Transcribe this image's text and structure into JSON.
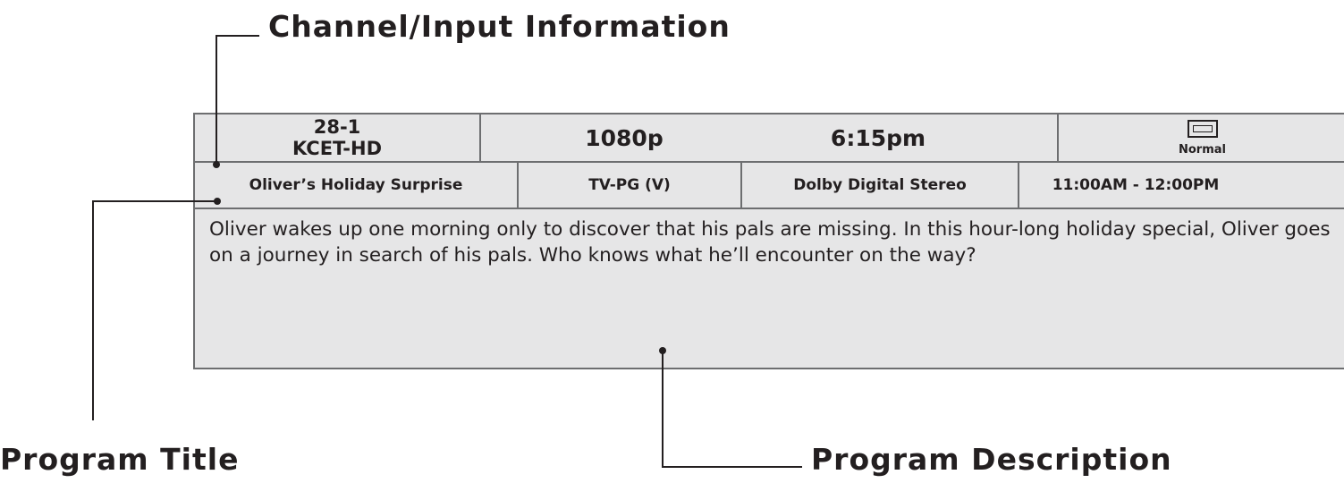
{
  "callouts": {
    "channel_input": "Channel/Input Information",
    "program_title": "Program Title",
    "program_description": "Program Description"
  },
  "banner": {
    "channel_number": "28-1",
    "channel_name": "KCET-HD",
    "resolution": "1080p",
    "time": "6:15pm",
    "picture_size_icon": "aspect-ratio-icon",
    "picture_size": "Normal",
    "program_title": "Oliver’s Holiday Surprise",
    "rating": "TV-PG (V)",
    "audio": "Dolby Digital Stereo",
    "time_slot": "11:00AM - 12:00PM",
    "description": "Oliver wakes up one morning only to discover that his pals are missing. In this hour-long holiday special, Oliver goes on a journey in search of his pals. Who knows what he’ll encounter on the way?"
  }
}
